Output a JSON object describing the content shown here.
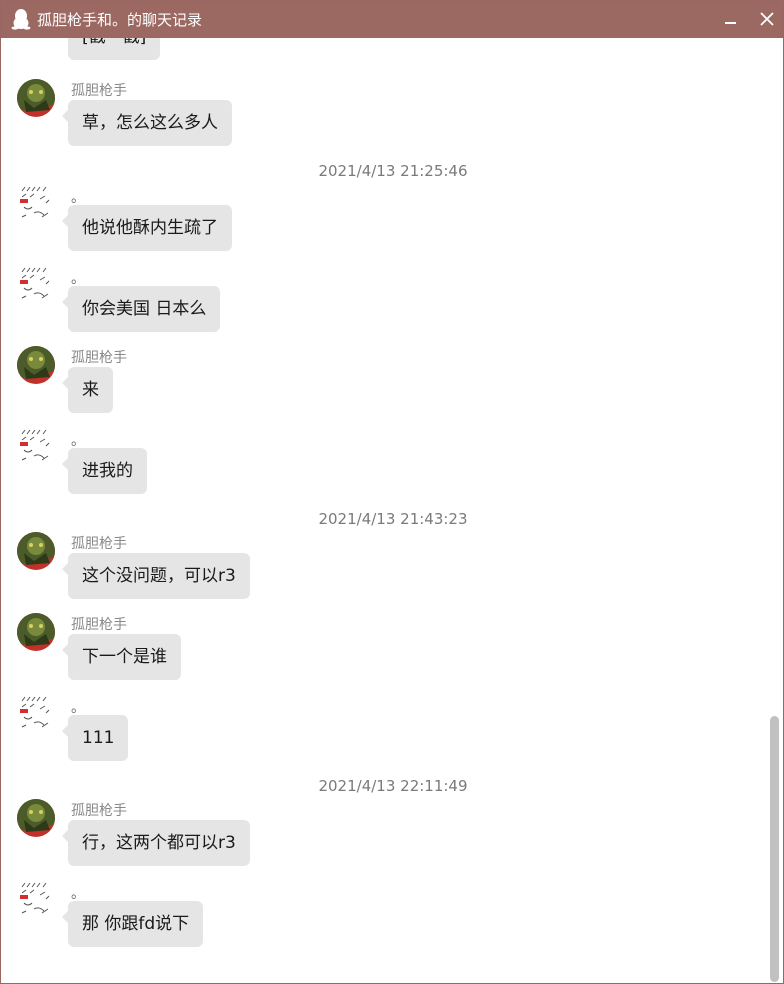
{
  "window": {
    "title": "孤胆枪手和。的聊天记录",
    "minimize_icon": "minimize-icon",
    "close_icon": "close-icon"
  },
  "messages": [
    {
      "type": "message",
      "sender": "",
      "avatar": "avatar-b",
      "text": "[戳一戳]"
    },
    {
      "type": "message",
      "sender": "孤胆枪手",
      "avatar": "avatar-a",
      "text": "草，怎么这么多人"
    },
    {
      "type": "timestamp",
      "text": "2021/4/13 21:25:46"
    },
    {
      "type": "message",
      "sender": "。",
      "avatar": "avatar-b",
      "text": "他说他酥内生疏了"
    },
    {
      "type": "message",
      "sender": "。",
      "avatar": "avatar-b",
      "text": "你会美国 日本么"
    },
    {
      "type": "message",
      "sender": "孤胆枪手",
      "avatar": "avatar-a",
      "text": "来"
    },
    {
      "type": "message",
      "sender": "。",
      "avatar": "avatar-b",
      "text": "进我的"
    },
    {
      "type": "timestamp",
      "text": "2021/4/13 21:43:23"
    },
    {
      "type": "message",
      "sender": "孤胆枪手",
      "avatar": "avatar-a",
      "text": "这个没问题，可以r3"
    },
    {
      "type": "message",
      "sender": "孤胆枪手",
      "avatar": "avatar-a",
      "text": "下一个是谁"
    },
    {
      "type": "message",
      "sender": "。",
      "avatar": "avatar-b",
      "text": "111"
    },
    {
      "type": "timestamp",
      "text": "2021/4/13 22:11:49"
    },
    {
      "type": "message",
      "sender": "孤胆枪手",
      "avatar": "avatar-a",
      "text": "行，这两个都可以r3"
    },
    {
      "type": "message",
      "sender": "。",
      "avatar": "avatar-b",
      "text": "那 你跟fd说下"
    }
  ],
  "colors": {
    "titlebar": "#9b6862",
    "bubble": "#e5e5e5",
    "timestamp_text": "#7a7a7a",
    "sender_text": "#888888"
  }
}
